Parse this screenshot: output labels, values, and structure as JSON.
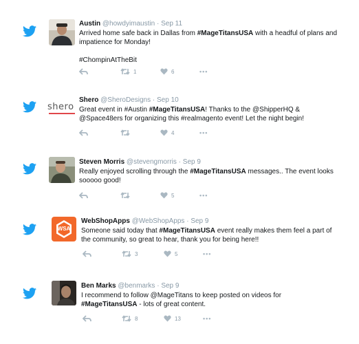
{
  "tweets": [
    {
      "name": "Austin",
      "handle": "@howdyimaustin",
      "date": "Sep 11",
      "body": [
        {
          "t": "Arrived home safe back in Dallas from ",
          "b": false
        },
        {
          "t": "#MageTitansUSA",
          "b": true
        },
        {
          "t": " with a headful of plans and impatience for Monday!\n\n#ChompinAtTheBit",
          "b": false
        }
      ],
      "retweets": "1",
      "likes": "6"
    },
    {
      "name": "Shero",
      "handle": "@SheroDesigns",
      "date": "Sep 10",
      "avatar_text": "shero",
      "body": [
        {
          "t": "Great event in #Austin ",
          "b": false
        },
        {
          "t": "#MageTitansUSA",
          "b": true
        },
        {
          "t": "! Thanks to the @ShipperHQ & @Space48ers for organizing this #realmagento event! Let the night begin!",
          "b": false
        }
      ],
      "retweets": "",
      "likes": "4"
    },
    {
      "name": "Steven Morris",
      "handle": "@stevengmorris",
      "date": "Sep 9",
      "body": [
        {
          "t": "Really enjoyed scrolling through the ",
          "b": false
        },
        {
          "t": "#MageTitansUSA",
          "b": true
        },
        {
          "t": " messages.. The event looks sooooo good!",
          "b": false
        }
      ],
      "retweets": "",
      "likes": "5"
    },
    {
      "name": "WebShopApps",
      "handle": "@WebShopApps",
      "date": "Sep 9",
      "avatar_text": "WSA",
      "body": [
        {
          "t": "Someone said today that ",
          "b": false
        },
        {
          "t": "#MageTitansUSA",
          "b": true
        },
        {
          "t": " event really makes them feel a part of the community, so great to hear, thank you for being here!!",
          "b": false
        }
      ],
      "retweets": "3",
      "likes": "5"
    },
    {
      "name": "Ben Marks",
      "handle": "@benmarks",
      "date": "Sep 9",
      "body": [
        {
          "t": "I recommend to follow @MageTitans to keep posted on videos for ",
          "b": false
        },
        {
          "t": "#MageTitansUSA",
          "b": true
        },
        {
          "t": " - lots of great content.",
          "b": false
        }
      ],
      "retweets": "8",
      "likes": "13"
    }
  ],
  "separator": "·",
  "more_glyph": "•••",
  "colors": {
    "twitter_blue": "#1da1f2",
    "action_gray": "#aab8c2",
    "meta_gray": "#8899a6",
    "wsa_orange": "#f2682a",
    "shero_red": "#e0464a"
  }
}
